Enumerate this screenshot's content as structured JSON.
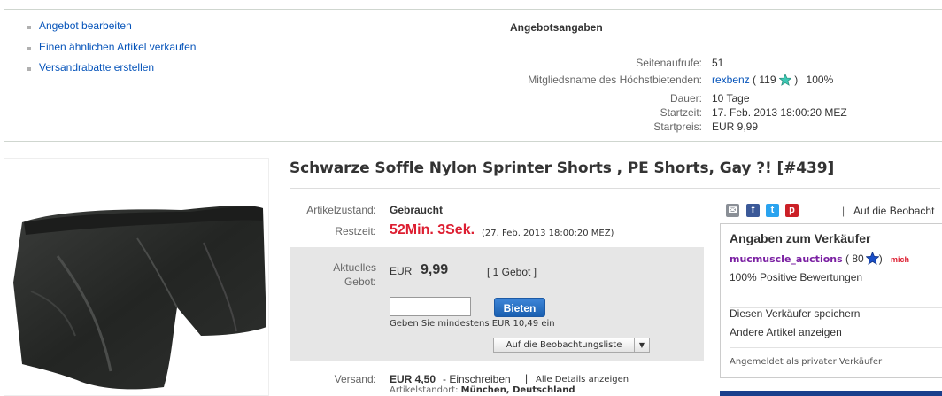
{
  "actions": [
    "Angebot bearbeiten",
    "Einen ähnlichen Artikel verkaufen",
    "Versandrabatte erstellen"
  ],
  "offer_info": {
    "title": "Angebotsangaben",
    "views_label": "Seitenaufrufe:",
    "views_value": "51",
    "bidder_label": "Mitgliedsname des Höchstbietenden:",
    "bidder_name": "rexbenz",
    "bidder_score_open": "( 119",
    "bidder_score_close": ")",
    "bidder_pct": "100%",
    "duration_label": "Dauer:",
    "duration_value": "10 Tage",
    "start_label": "Startzeit:",
    "start_value": "17. Feb. 2013 18:00:20 MEZ",
    "startprice_label": "Startpreis:",
    "startprice_value": "EUR 9,99"
  },
  "item": {
    "title": "Schwarze Soffle Nylon Sprinter Shorts , PE Shorts, Gay ?! [#439]",
    "condition_label": "Artikelzustand:",
    "condition_value": "Gebraucht",
    "remaining_label": "Restzeit:",
    "remaining_value": "52Min. 3Sek.",
    "remaining_end": "(27. Feb. 2013 18:00:20 MEZ)",
    "current_bid_label_1": "Aktuelles",
    "current_bid_label_2": "Gebot:",
    "current_bid_currency": "EUR",
    "current_bid_amount": "9,99",
    "bids_link": "[ 1 Gebot ]",
    "bid_button": "Bieten",
    "min_bid_hint": "Geben Sie mindestens EUR 10,49 ein",
    "watch_button": "Auf die Beobachtungsliste",
    "shipping_label": "Versand:",
    "shipping_value": "EUR 4,50",
    "shipping_method": "- Einschreiben",
    "shipping_sep": "|",
    "shipping_details_link": "Alle Details anzeigen",
    "location_label": "Artikelstandort:",
    "location_value": "München, Deutschland"
  },
  "share": {
    "separator": "|",
    "watch_link": "Auf die Beobacht"
  },
  "seller": {
    "heading": "Angaben zum Verkäufer",
    "name": "mucmuscle_auctions",
    "score_open": "( 80",
    "score_close": ")",
    "me_badge": "mich",
    "positive": "100% Positive Bewertungen",
    "save_link": "Diesen Verkäufer speichern",
    "other_items_link": "Andere Artikel anzeigen",
    "private_note": "Angemeldet als privater Verkäufer"
  },
  "colors": {
    "link": "#0654ba",
    "remaining": "#dd1e31",
    "seller_name": "#7a1fa2",
    "bid_button": "#2a70c6",
    "bidbox": "#e6e6e6"
  },
  "icons": [
    "turquoise-star-icon",
    "blue-star-icon",
    "email-share-icon",
    "facebook-icon",
    "twitter-icon",
    "pinterest-icon",
    "dropdown-caret-icon"
  ]
}
